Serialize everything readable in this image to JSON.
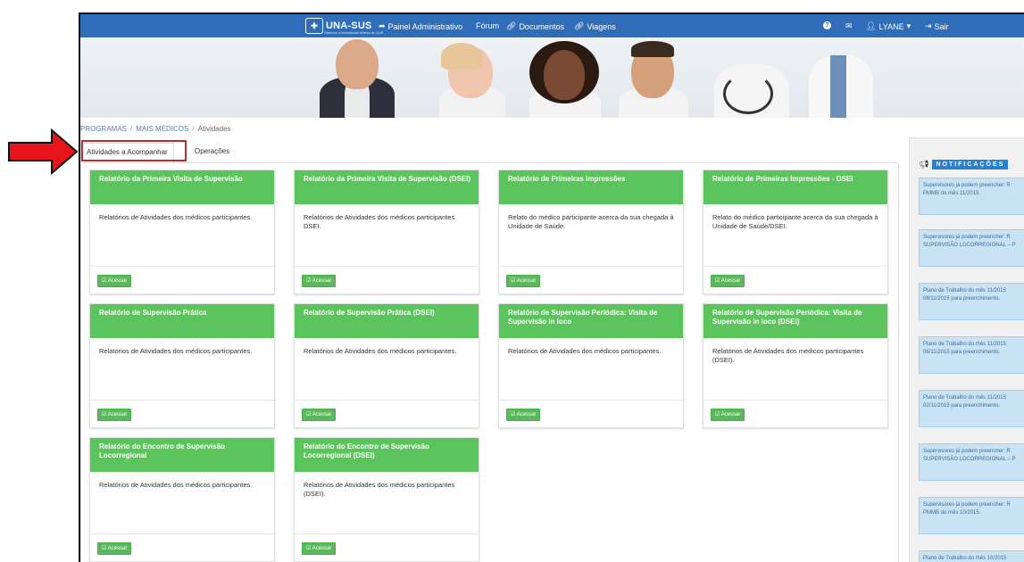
{
  "navbar": {
    "logo_text": "UNA-SUS",
    "logo_sub": "Sistema Universidade Aberta do SUS",
    "items": [
      {
        "label": "Painel Administrativo",
        "icon": "arrow-icon"
      },
      {
        "label": "Fórum",
        "icon": ""
      },
      {
        "label": "Documentos",
        "icon": "link-icon"
      },
      {
        "label": "Viagens",
        "icon": "link-icon"
      }
    ],
    "user": "LYANE",
    "logout": "Sair"
  },
  "breadcrumb": [
    "PROGRAMAS",
    "MAIS MÉDICOS",
    "Atividades"
  ],
  "tabs": [
    "Atividades a Acompanhar",
    "Operações"
  ],
  "cards": [
    {
      "title": "Relatório da Primeira Visita de Supervisão",
      "desc": "Relatórios de Atividades dos médicos participantes.",
      "button": "Acessar"
    },
    {
      "title": "Relatório da Primeira Visita de Supervisão (DSEI)",
      "desc": "Relatórios de Atividades dos médicos participantes DSEI.",
      "button": "Acessar"
    },
    {
      "title": "Relatório de Primeiras Impressões",
      "desc": "Relato do médico participante acerca da sua chegada à Unidade de Saúde.",
      "button": "Acessar"
    },
    {
      "title": "Relatório de Primeiras Impressões - DSEI",
      "desc": "Relato do médico participante acerca da sua chegada à Unidade de Saúde/DSEI.",
      "button": "Acessar"
    },
    {
      "title": "Relatório de Supervisão Prática",
      "desc": "Relatórios de Atividades dos médicos participantes.",
      "button": "Acessar"
    },
    {
      "title": "Relatório de Supervisão Prática (DSEI)",
      "desc": "Relatórios de Atividades dos médicos participantes.",
      "button": "Acessar"
    },
    {
      "title": "Relatório de Supervisão Periódica: Visita de Supervisão in loco",
      "desc": "Relatórios de Atividades dos médicos participantes.",
      "button": "Acessar"
    },
    {
      "title": "Relatório de Supervisão Periódica: Visita de Supervisão in loco (DSEI)",
      "desc": "Relatórios de Atividades dos médicos participantes (DSEI).",
      "button": "Acessar"
    },
    {
      "title": "Relatório do Encontro de Supervisão Locorregional",
      "desc": "Relatórios de Atividades dos médicos participantes.",
      "button": "Acessar"
    },
    {
      "title": "Relatório do Encontro de Supervisão Locorregional (DSEI)",
      "desc": "Relatórios de Atividades dos médicos participantes (DSEI).",
      "button": "Acessar"
    }
  ],
  "notifications": {
    "title": "NOTIFICAÇÕES",
    "items": [
      {
        "line1": "Supervisores já podem preencher: R",
        "line2": "PMMB do mês 11/2015."
      },
      {
        "line1": "Supervisores já podem preencher: R",
        "line2": "SUPERVISÃO LOCORREGIONAL – P"
      },
      {
        "line1": "Plano de Trabalho do mês 11/2015",
        "line2": "08/11/2015 para preenchimento."
      },
      {
        "line1": "Plano de Trabalho do mês 11/2015",
        "line2": "06/11/2015 para preenchimento."
      },
      {
        "line1": "Plano de Trabalho do mês 11/2015",
        "line2": "02/11/2015 para preenchimento."
      },
      {
        "line1": "Supervisores já podem preencher: R",
        "line2": "SUPERVISÃO LOCORREGIONAL – P"
      },
      {
        "line1": "Supervisores já podem preencher: R",
        "line2": "PMMB do mês 10/2015."
      },
      {
        "line1": "Plano de Trabalho do mês 10/2015",
        "line2": ""
      }
    ]
  },
  "colors": {
    "navbar": "#2f6db8",
    "card_header": "#5cc45c",
    "highlight": "#b0302c",
    "arrow": "#e8141b"
  }
}
